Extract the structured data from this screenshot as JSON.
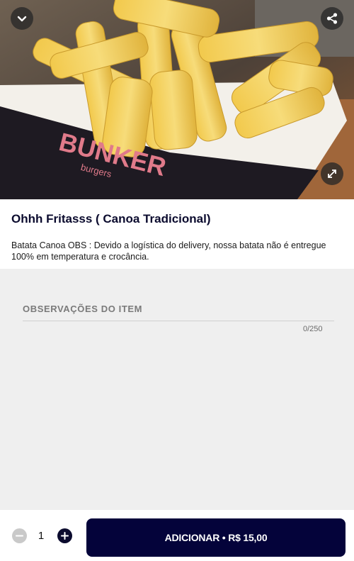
{
  "product": {
    "title": "Ohhh Fritasss ( Canoa Tradicional)",
    "description": "Batata Canoa OBS : Devido a logística do delivery, nossa batata não é entregue 100% em temperatura e crocância.",
    "image_alt": "Batata frita em embalagem Bunker Burgers",
    "packaging_text": "BUNKER",
    "packaging_subtext": "burgers"
  },
  "icons": {
    "collapse": "chevron-down-icon",
    "share": "share-icon",
    "expand": "expand-icon",
    "minus": "minus-icon",
    "plus": "plus-icon"
  },
  "observations": {
    "label": "OBSERVAÇÕES DO ITEM",
    "value": "",
    "counter": "0/250"
  },
  "footer": {
    "quantity": "1",
    "add_button_label": "ADICIONAR • R$ 15,00"
  },
  "colors": {
    "primary": "#04033a",
    "background": "#efefef",
    "minus_disabled": "#c9c9c9"
  }
}
